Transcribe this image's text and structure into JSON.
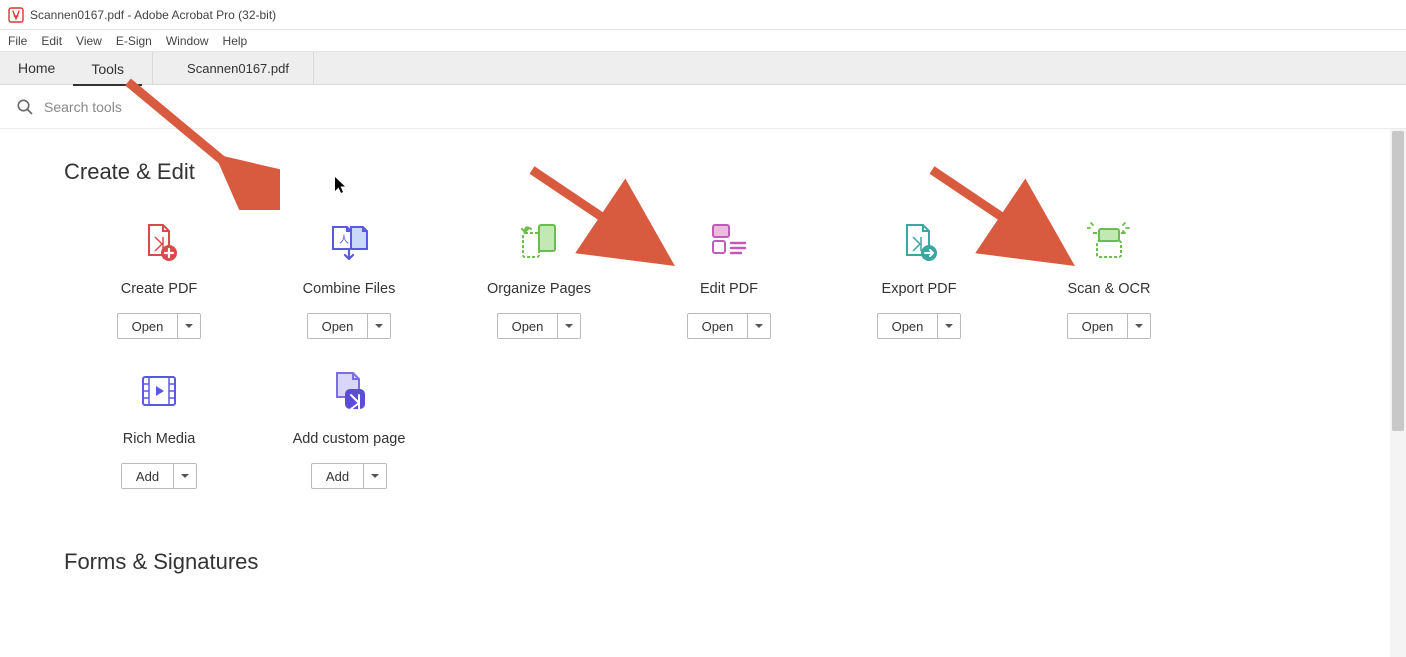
{
  "titlebar": {
    "title": "Scannen0167.pdf - Adobe Acrobat Pro (32-bit)"
  },
  "menu": {
    "items": [
      "File",
      "Edit",
      "View",
      "E-Sign",
      "Window",
      "Help"
    ]
  },
  "tabs": {
    "main": [
      {
        "label": "Home",
        "active": false
      },
      {
        "label": "Tools",
        "active": true
      }
    ],
    "doc": "Scannen0167.pdf"
  },
  "search": {
    "placeholder": "Search tools"
  },
  "sections": {
    "create_edit": {
      "title": "Create & Edit",
      "tools": [
        {
          "name": "Create PDF",
          "button": "Open"
        },
        {
          "name": "Combine Files",
          "button": "Open"
        },
        {
          "name": "Organize Pages",
          "button": "Open"
        },
        {
          "name": "Edit PDF",
          "button": "Open"
        },
        {
          "name": "Export PDF",
          "button": "Open"
        },
        {
          "name": "Scan & OCR",
          "button": "Open"
        },
        {
          "name": "Rich Media",
          "button": "Add"
        },
        {
          "name": "Add custom page",
          "button": "Add"
        }
      ]
    },
    "forms_signatures": {
      "title": "Forms & Signatures"
    }
  }
}
